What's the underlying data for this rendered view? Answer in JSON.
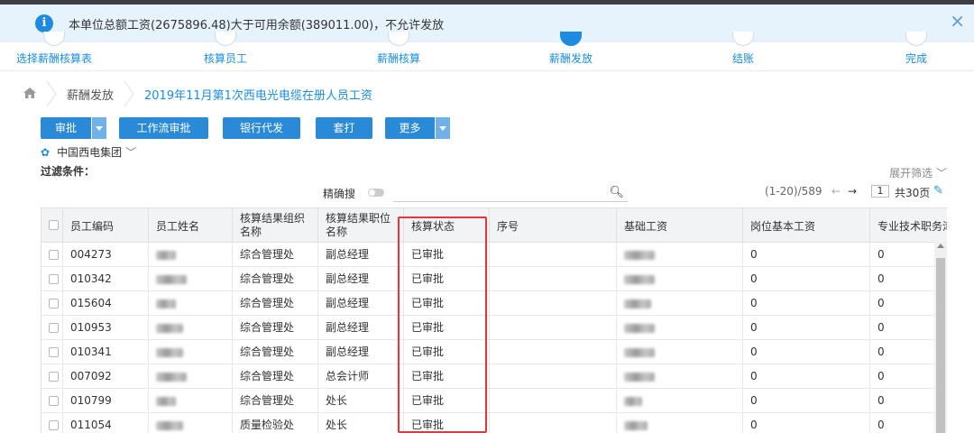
{
  "alert": {
    "message": "本单位总额工资(2675896.48)大于可用余额(389011.00)，不允许发放",
    "info_icon": "i",
    "close_icon": "×"
  },
  "steps": [
    {
      "label": "选择薪酬核算表",
      "active": false
    },
    {
      "label": "核算员工",
      "active": false
    },
    {
      "label": "薪酬核算",
      "active": false
    },
    {
      "label": "薪酬发放",
      "active": true
    },
    {
      "label": "结账",
      "active": false
    },
    {
      "label": "完成",
      "active": false
    }
  ],
  "breadcrumb": {
    "items": [
      "薪酬发放",
      "2019年11月第1次西电光电缆在册人员工资"
    ]
  },
  "toolbar": {
    "approve": "审批",
    "workflow_approve": "工作流审批",
    "bank_pay": "银行代发",
    "print": "套打",
    "more": "更多"
  },
  "org": {
    "name": "中国西电集团"
  },
  "filter": {
    "label": "过滤条件：",
    "expand": "展开筛选",
    "exact_search": "精确搜",
    "search_placeholder": ""
  },
  "pager": {
    "range": "(1-20)/589",
    "page": "1",
    "total": "共30页"
  },
  "table": {
    "columns": [
      "员工编码",
      "员工姓名",
      "核算结果组织名称",
      "核算结果职位名称",
      "核算状态",
      "序号",
      "基础工资",
      "岗位基本工资",
      "专业技术职务津"
    ],
    "rows": [
      {
        "code": "004273",
        "org": "综合管理处",
        "position": "副总经理",
        "status": "已审批",
        "seq": "",
        "post_base": "0",
        "tech": "0"
      },
      {
        "code": "010342",
        "org": "综合管理处",
        "position": "副总经理",
        "status": "已审批",
        "seq": "",
        "post_base": "0",
        "tech": "0"
      },
      {
        "code": "015604",
        "org": "综合管理处",
        "position": "副总经理",
        "status": "已审批",
        "seq": "",
        "post_base": "0",
        "tech": "0"
      },
      {
        "code": "010953",
        "org": "综合管理处",
        "position": "副总经理",
        "status": "已审批",
        "seq": "",
        "post_base": "0",
        "tech": "0"
      },
      {
        "code": "010341",
        "org": "综合管理处",
        "position": "副总经理",
        "status": "已审批",
        "seq": "",
        "post_base": "0",
        "tech": "0"
      },
      {
        "code": "007092",
        "org": "综合管理处",
        "position": "总会计师",
        "status": "已审批",
        "seq": "",
        "post_base": "0",
        "tech": "0"
      },
      {
        "code": "010799",
        "org": "综合管理处",
        "position": "处长",
        "status": "已审批",
        "seq": "",
        "post_base": "0",
        "tech": "0"
      },
      {
        "code": "011054",
        "org": "质量检验处",
        "position": "处长",
        "status": "已审批",
        "seq": "",
        "post_base": "0",
        "tech": "0"
      }
    ]
  },
  "colors": {
    "primary": "#2b8ad8",
    "alert_bg": "#e6f3fd",
    "highlight": "#e8353d"
  }
}
